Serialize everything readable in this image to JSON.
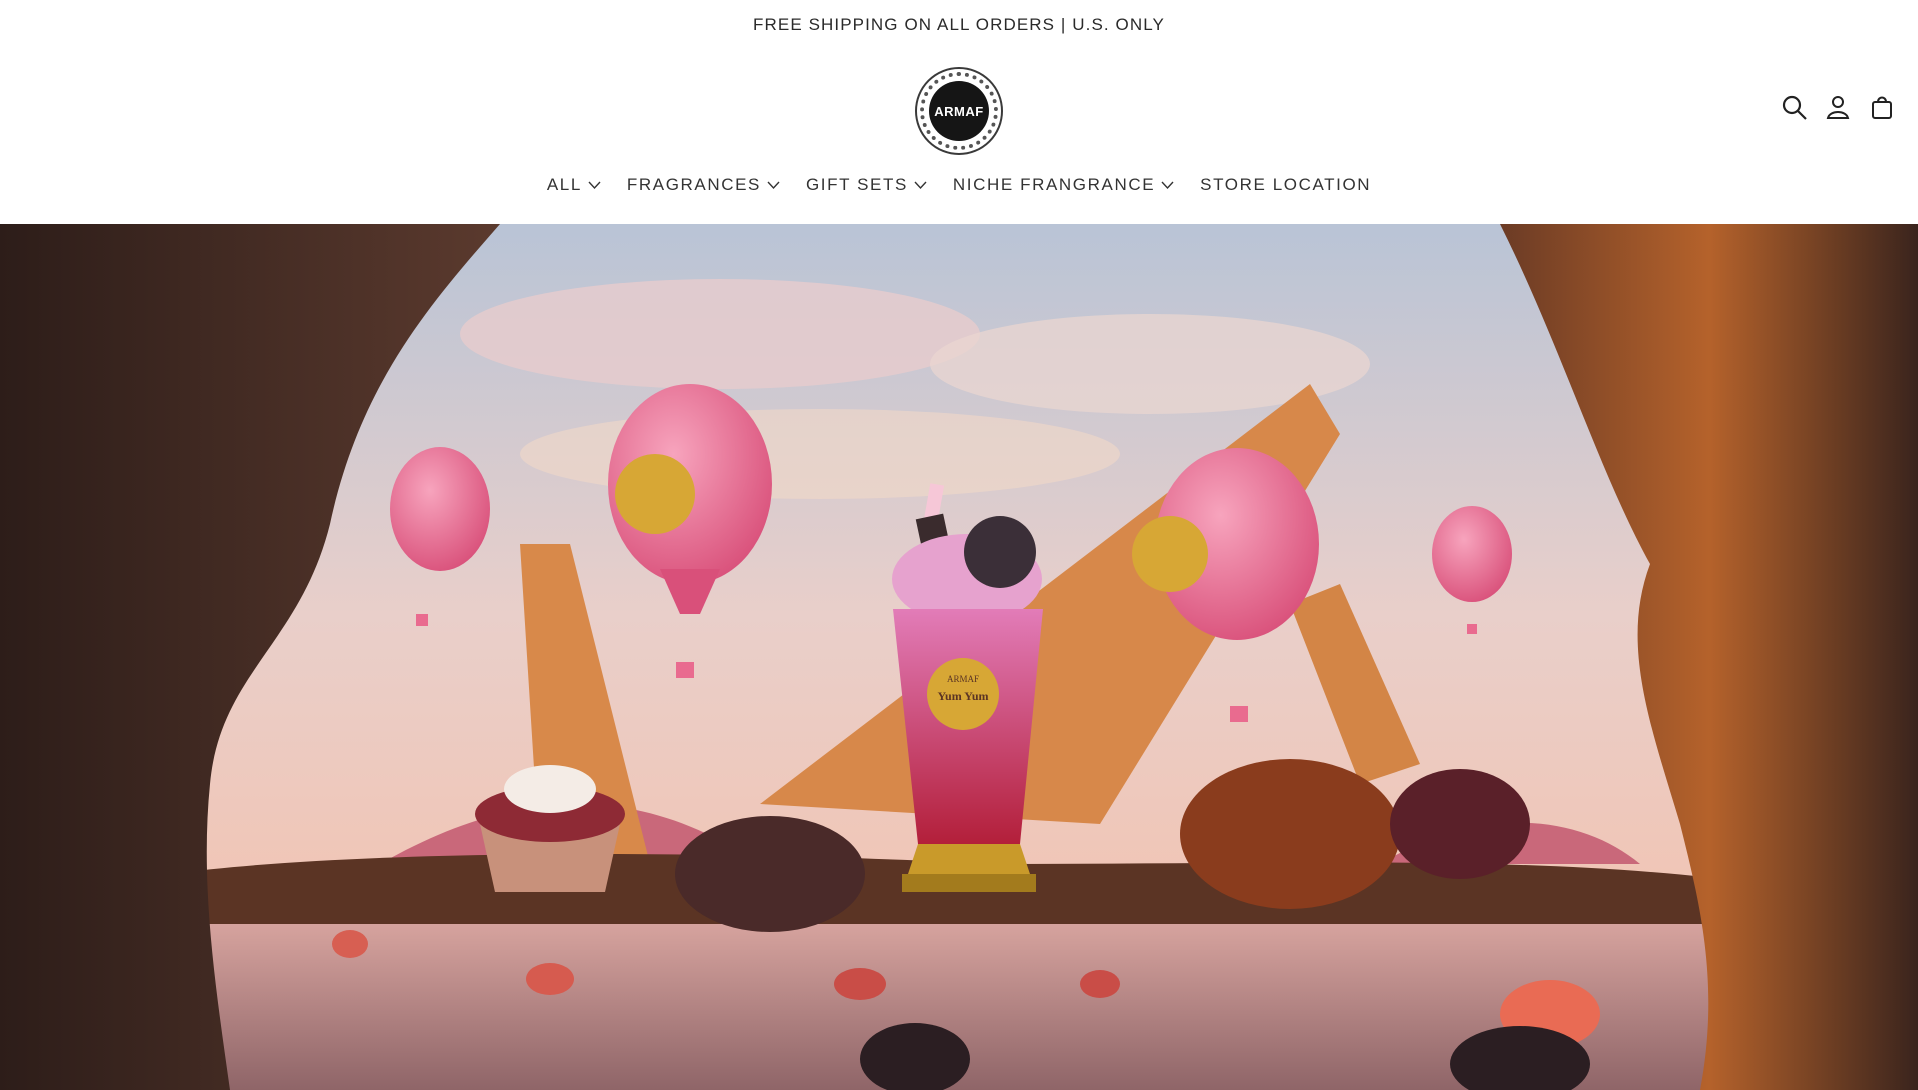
{
  "announcement": {
    "text": "FREE SHIPPING ON ALL ORDERS | U.S. ONLY"
  },
  "brand": {
    "logo_text": "ARMAF",
    "logo_icon": "brand-seal-logo"
  },
  "header_icons": [
    {
      "name": "search-icon"
    },
    {
      "name": "account-icon"
    },
    {
      "name": "cart-icon"
    }
  ],
  "nav": {
    "items": [
      {
        "label": "ALL",
        "has_dropdown": true
      },
      {
        "label": "FRAGRANCES",
        "has_dropdown": true
      },
      {
        "label": "GIFT SETS",
        "has_dropdown": true
      },
      {
        "label": "NICHE FRANGRANCE",
        "has_dropdown": true
      },
      {
        "label": "STORE LOCATION",
        "has_dropdown": false
      }
    ]
  },
  "hero": {
    "bottle_brand": "ARMAF",
    "bottle_name": "Yum Yum"
  },
  "colors": {
    "sky_top": "#b9c4d6",
    "sky_mid": "#e9c7c3",
    "balloon_pink": "#e96b8f",
    "cone": "#d8894a",
    "chocolate": "#5b3424",
    "foreground_rock": "#3a2620"
  }
}
